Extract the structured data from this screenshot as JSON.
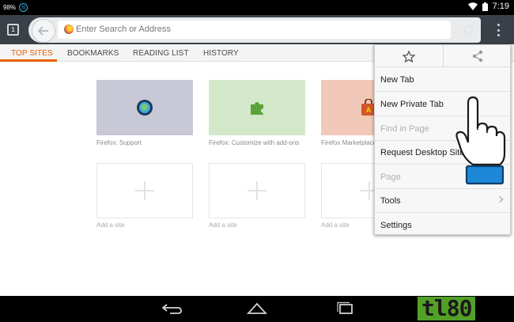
{
  "status_bar": {
    "battery_text": "98%",
    "notification_text": "35",
    "time": "7:19"
  },
  "toolbar": {
    "tabs_count": "1",
    "url_placeholder": "Enter Search or Address"
  },
  "home_tabs": [
    {
      "label": "TOP SITES",
      "active": true
    },
    {
      "label": "BOOKMARKS",
      "active": false
    },
    {
      "label": "READING LIST",
      "active": false
    },
    {
      "label": "HISTORY",
      "active": false
    }
  ],
  "tiles": [
    {
      "label": "Firefox: Support",
      "bg": "#c8c8d6",
      "icon": "firefox-support-icon"
    },
    {
      "label": "Firefox: Customize with add-ons",
      "bg": "#d3e8c8",
      "icon": "puzzle-addon-icon"
    },
    {
      "label": "Firefox Marketplace",
      "bg": "#f2c8b8",
      "icon": "marketplace-bag-icon"
    },
    {
      "label": "Add a site"
    },
    {
      "label": "Add a site"
    },
    {
      "label": "Add a site"
    }
  ],
  "menu": {
    "items": [
      {
        "label": "New Tab",
        "enabled": true
      },
      {
        "label": "New Private Tab",
        "enabled": true
      },
      {
        "label": "Find in Page",
        "enabled": false
      },
      {
        "label": "Request Desktop Site",
        "enabled": true,
        "checkbox": true
      },
      {
        "label": "Page",
        "enabled": false,
        "submenu": true
      },
      {
        "label": "Tools",
        "enabled": true,
        "submenu": true
      },
      {
        "label": "Settings",
        "enabled": true
      }
    ]
  },
  "watermark": "tl80",
  "colors": {
    "accent": "#e66000",
    "toolbar": "#3a4047",
    "hand_cuff": "#1e88d8",
    "watermark_green": "#53a028"
  }
}
